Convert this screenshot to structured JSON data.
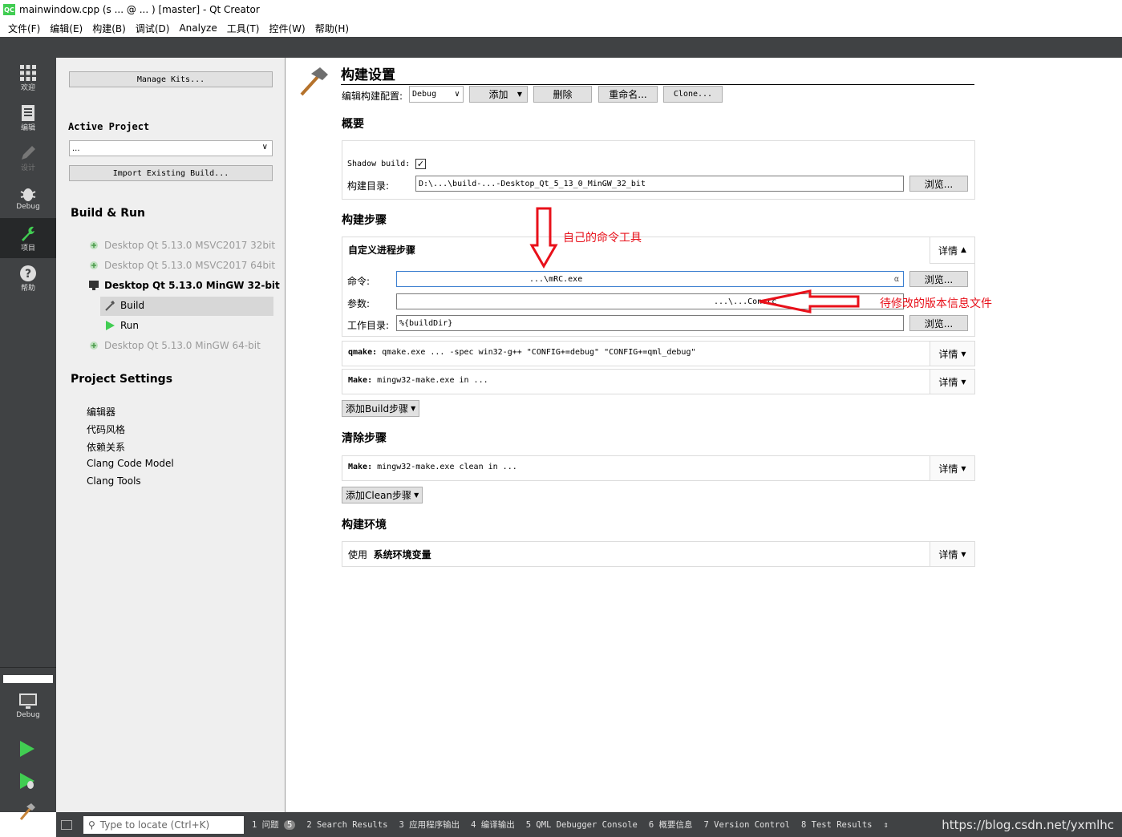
{
  "window": {
    "title": "mainwindow.cpp (s  ...  @ ...  ) [master] - Qt Creator",
    "logo": "QC"
  },
  "menu": [
    "文件(F)",
    "编辑(E)",
    "构建(B)",
    "调试(D)",
    "Analyze",
    "工具(T)",
    "控件(W)",
    "帮助(H)"
  ],
  "modes": [
    {
      "label": "欢迎",
      "icon": "grid-icon"
    },
    {
      "label": "编辑",
      "icon": "document-icon"
    },
    {
      "label": "设计",
      "icon": "pencil-icon"
    },
    {
      "label": "Debug",
      "icon": "bug-icon"
    },
    {
      "label": "项目",
      "icon": "wrench-icon"
    },
    {
      "label": "帮助",
      "icon": "help-icon"
    }
  ],
  "bottom_modes": {
    "target_label": "Debug"
  },
  "kits": {
    "manage_kits": "Manage Kits...",
    "active_project_label": "Active Project",
    "active_project_value": "...",
    "import_build": "Import Existing Build...",
    "build_run_label": "Build & Run",
    "kit_list": [
      {
        "name": "Desktop Qt 5.13.0 MSVC2017 32bit",
        "enabled": false
      },
      {
        "name": "Desktop Qt 5.13.0 MSVC2017 64bit",
        "enabled": false
      },
      {
        "name": "Desktop Qt 5.13.0 MinGW 32-bit",
        "enabled": true
      },
      {
        "name": "Desktop Qt 5.13.0 MinGW 64-bit",
        "enabled": false
      }
    ],
    "sub_build": "Build",
    "sub_run": "Run",
    "project_settings_label": "Project Settings",
    "project_settings": [
      "编辑器",
      "代码风格",
      "依赖关系",
      "Clang Code Model",
      "Clang Tools"
    ]
  },
  "build_settings": {
    "title": "构建设置",
    "edit_config_label": "编辑构建配置:",
    "config_value": "Debug",
    "add": "添加",
    "delete": "删除",
    "rename": "重命名...",
    "clone": "Clone...",
    "overview_label": "概要",
    "shadow_build_label": "Shadow build:",
    "build_dir_label": "构建目录:",
    "build_dir_value": "D:\\...\\build-...-Desktop_Qt_5_13_0_MinGW_32_bit",
    "browse": "浏览...",
    "build_steps_label": "构建步骤",
    "custom_step_title": "自定义进程步骤",
    "details": "详情",
    "command_label": "命令:",
    "command_value": "...\\mRC.exe",
    "args_label": "参数:",
    "args_value": "...\\...Con.rc",
    "workdir_label": "工作目录:",
    "workdir_value": "%{buildDir}",
    "qmake_prefix": "qmake:",
    "qmake_value": "qmake.exe ...   -spec win32-g++ \"CONFIG+=debug\" \"CONFIG+=qml_debug\"",
    "make_prefix": "Make:",
    "make_value": "mingw32-make.exe in  ...",
    "add_build_step": "添加Build步骤",
    "clean_steps_label": "清除步骤",
    "clean_make_value": "mingw32-make.exe clean in  ...",
    "add_clean_step": "添加Clean步骤",
    "build_env_label": "构建环境",
    "env_prefix": "使用",
    "env_value": "系统环境变量"
  },
  "annotations": {
    "own_tool": "自己的命令工具",
    "version_file": "待修改的版本信息文件"
  },
  "statusbar": {
    "locate_placeholder": "Type to locate (Ctrl+K)",
    "items": [
      "1 问题",
      "2 Search Results",
      "3 应用程序输出",
      "4 编译输出",
      "5 QML Debugger Console",
      "6 概要信息",
      "7 Version Control",
      "8 Test Results"
    ],
    "problem_count": "5"
  },
  "watermark": "https://blog.csdn.net/yxmlhc",
  "colors": {
    "sidebar": "#404244",
    "active_mode": "#262829",
    "annotation": "#e8101a",
    "qt_green": "#41cd52"
  }
}
